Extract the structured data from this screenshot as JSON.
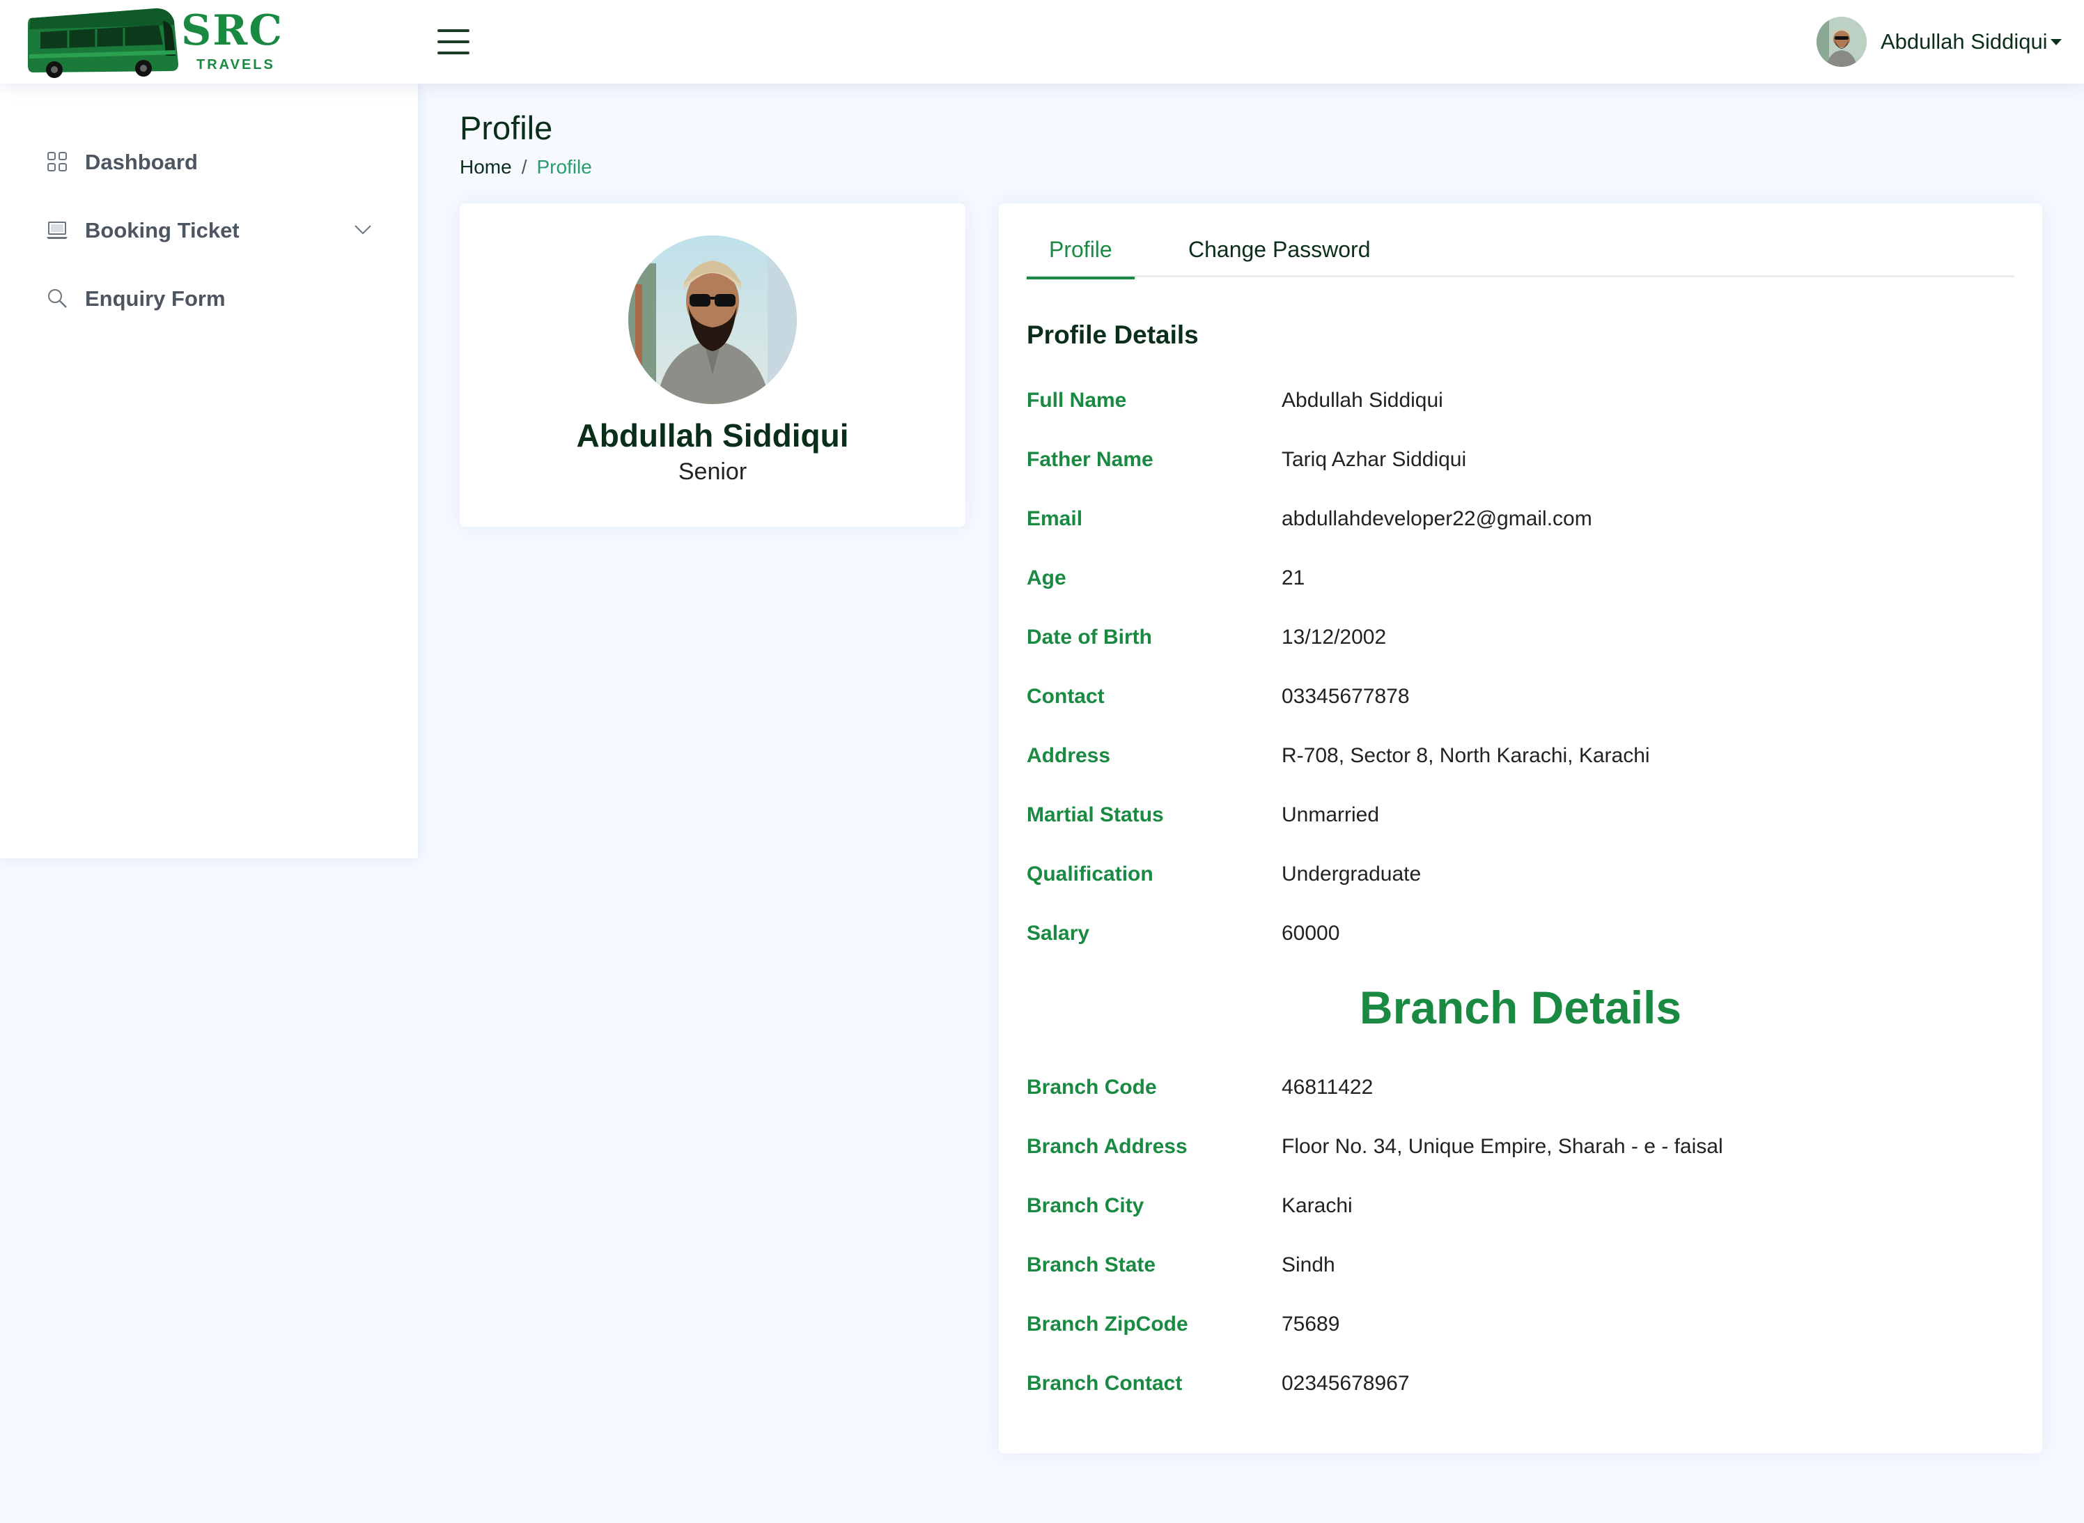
{
  "header": {
    "logo_text": "SRC",
    "logo_subtext": "TRAVELS",
    "user_name": "Abdullah Siddiqui"
  },
  "sidebar": {
    "items": [
      {
        "label": "Dashboard",
        "icon": "grid-icon"
      },
      {
        "label": "Booking Ticket",
        "icon": "laptop-icon",
        "has_submenu": true
      },
      {
        "label": "Enquiry Form",
        "icon": "search-icon"
      }
    ]
  },
  "page": {
    "title": "Profile",
    "breadcrumb": {
      "home": "Home",
      "separator": "/",
      "current": "Profile"
    }
  },
  "profile_card": {
    "name": "Abdullah Siddiqui",
    "role": "Senior"
  },
  "tabs": [
    {
      "label": "Profile",
      "active": true
    },
    {
      "label": "Change Password",
      "active": false
    }
  ],
  "profile_details": {
    "title": "Profile Details",
    "fields": [
      {
        "label": "Full Name",
        "value": "Abdullah Siddiqui"
      },
      {
        "label": "Father Name",
        "value": "Tariq Azhar Siddiqui"
      },
      {
        "label": "Email",
        "value": "abdullahdeveloper22@gmail.com"
      },
      {
        "label": "Age",
        "value": "21"
      },
      {
        "label": "Date of Birth",
        "value": "13/12/2002"
      },
      {
        "label": "Contact",
        "value": "03345677878"
      },
      {
        "label": "Address",
        "value": "R-708, Sector 8, North Karachi, Karachi"
      },
      {
        "label": "Martial Status",
        "value": "Unmarried"
      },
      {
        "label": "Qualification",
        "value": "Undergraduate"
      },
      {
        "label": "Salary",
        "value": "60000"
      }
    ]
  },
  "branch_details": {
    "title": "Branch Details",
    "fields": [
      {
        "label": "Branch Code",
        "value": "46811422"
      },
      {
        "label": "Branch Address",
        "value": "Floor No. 34, Unique Empire, Sharah - e - faisal"
      },
      {
        "label": "Branch City",
        "value": "Karachi"
      },
      {
        "label": "Branch State",
        "value": "Sindh"
      },
      {
        "label": "Branch ZipCode",
        "value": "75689"
      },
      {
        "label": "Branch Contact",
        "value": "02345678967"
      }
    ]
  },
  "colors": {
    "accent_green": "#1a8a42",
    "page_background": "#f6f9ff",
    "heading_dark": "#0a2e1a"
  }
}
